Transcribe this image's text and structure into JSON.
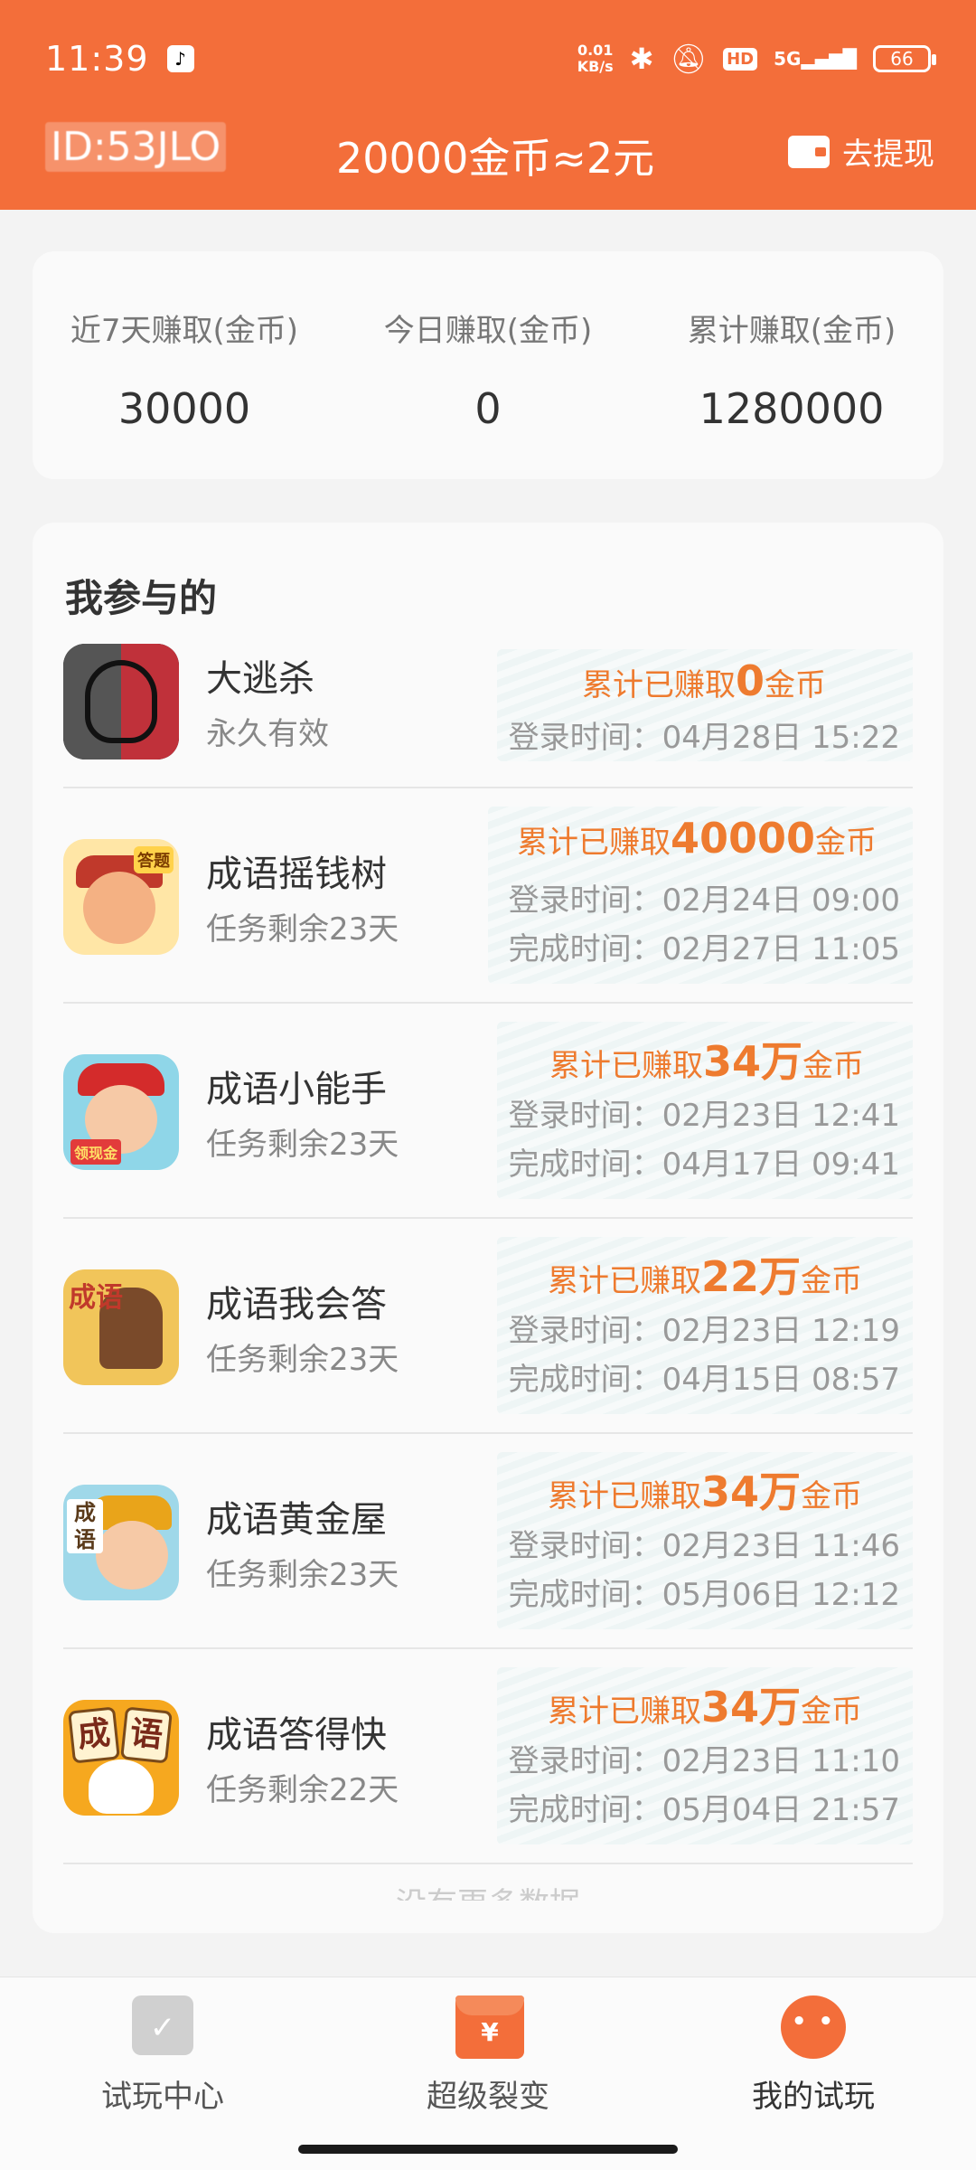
{
  "status_bar": {
    "time": "11:39",
    "net_speed_top": "0.01",
    "net_speed_bottom": "KB/s",
    "hd_badge": "HD",
    "signal": "5G",
    "battery": "66"
  },
  "header": {
    "user_id": "ID:53JLO",
    "rate": "20000金币≈2元",
    "withdraw_label": "去提现",
    "accent_color": "#f36e3a"
  },
  "stats": [
    {
      "label": "近7天赚取(金币)",
      "value": "30000"
    },
    {
      "label": "今日赚取(金币)",
      "value": "0"
    },
    {
      "label": "累计赚取(金币)",
      "value": "1280000"
    }
  ],
  "list": {
    "title": "我参与的",
    "footer_text": "没有更多数据",
    "games": [
      {
        "name": "大逃杀",
        "sub": "永久有效",
        "earn_prefix": "累计已赚取",
        "earn_amount": "0",
        "earn_suffix": "金币",
        "login_label": "登录时间：",
        "login_time": "04月28日 15:22",
        "complete_label": "",
        "complete_time": ""
      },
      {
        "name": "成语摇钱树",
        "sub": "任务剩余23天",
        "earn_prefix": "累计已赚取",
        "earn_amount": "40000",
        "earn_suffix": "金币",
        "login_label": "登录时间：",
        "login_time": "02月24日 09:00",
        "complete_label": "完成时间：",
        "complete_time": "02月27日 11:05",
        "icon_tag": "答题"
      },
      {
        "name": "成语小能手",
        "sub": "任务剩余23天",
        "earn_prefix": "累计已赚取",
        "earn_amount": "34万",
        "earn_suffix": "金币",
        "login_label": "登录时间：",
        "login_time": "02月23日 12:41",
        "complete_label": "完成时间：",
        "complete_time": "04月17日 09:41",
        "icon_tag": "领现金"
      },
      {
        "name": "成语我会答",
        "sub": "任务剩余23天",
        "earn_prefix": "累计已赚取",
        "earn_amount": "22万",
        "earn_suffix": "金币",
        "login_label": "登录时间：",
        "login_time": "02月23日 12:19",
        "complete_label": "完成时间：",
        "complete_time": "04月15日 08:57",
        "icon_tag": "成语"
      },
      {
        "name": "成语黄金屋",
        "sub": "任务剩余23天",
        "earn_prefix": "累计已赚取",
        "earn_amount": "34万",
        "earn_suffix": "金币",
        "login_label": "登录时间：",
        "login_time": "02月23日 11:46",
        "complete_label": "完成时间：",
        "complete_time": "05月06日 12:12",
        "icon_tag": "成语"
      },
      {
        "name": "成语答得快",
        "sub": "任务剩余22天",
        "earn_prefix": "累计已赚取",
        "earn_amount": "34万",
        "earn_suffix": "金币",
        "login_label": "登录时间：",
        "login_time": "02月23日 11:10",
        "complete_label": "完成时间：",
        "complete_time": "05月04日 21:57",
        "icon_tag_1": "成",
        "icon_tag_2": "语"
      }
    ]
  },
  "bottom_nav": [
    {
      "label": "试玩中心",
      "icon": "calendar-check-icon"
    },
    {
      "label": "超级裂变",
      "icon": "red-envelope-icon"
    },
    {
      "label": "我的试玩",
      "icon": "mascot-icon",
      "active": true
    }
  ]
}
